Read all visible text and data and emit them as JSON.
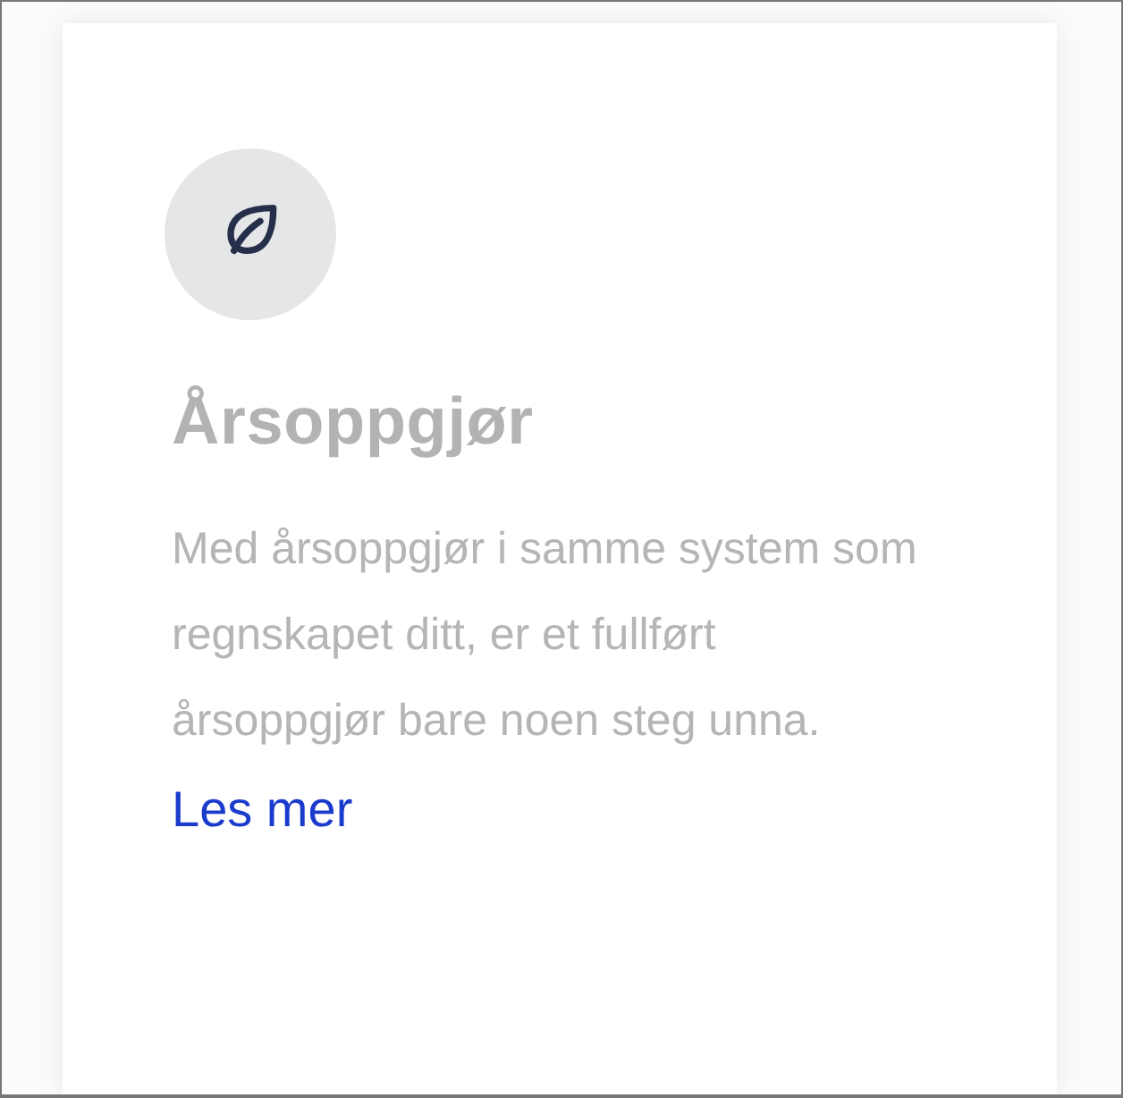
{
  "card": {
    "title": "Årsoppgjør",
    "description": "Med årsoppgjør i samme system som regnskapet ditt, er et fullført årsoppgjør bare noen steg unna.",
    "link": "Les mer"
  }
}
